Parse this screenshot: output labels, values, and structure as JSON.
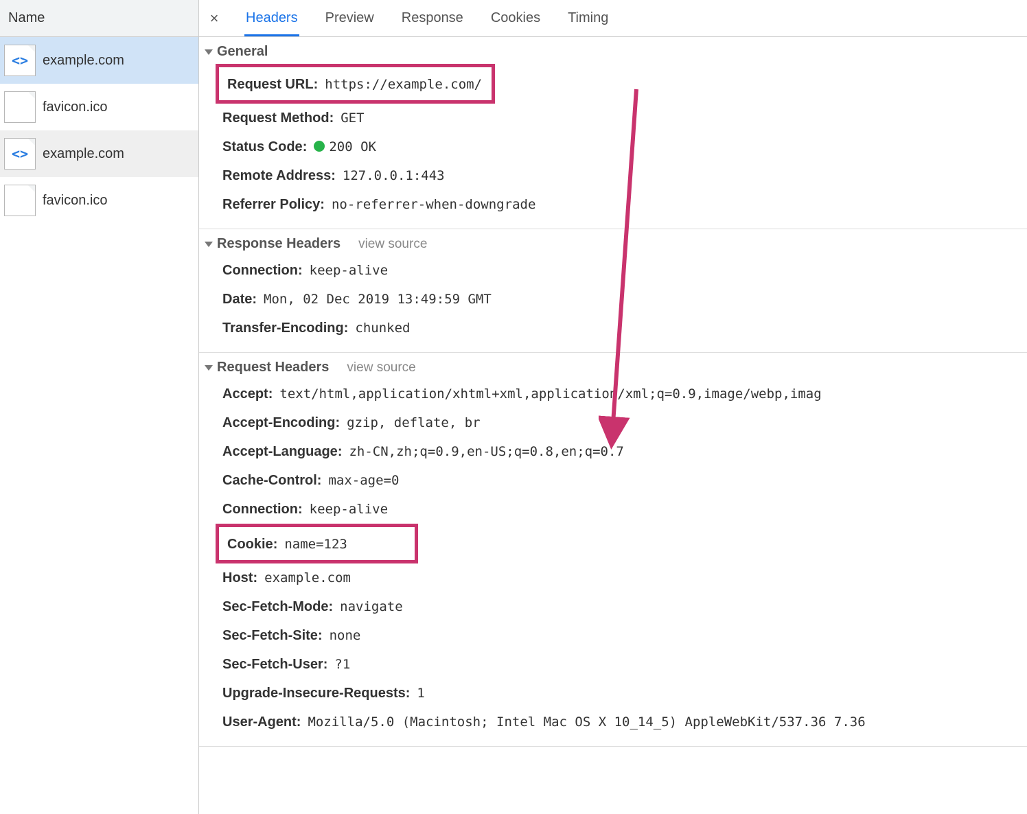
{
  "sidebar": {
    "header": "Name",
    "items": [
      {
        "label": "example.com",
        "icon": "doc",
        "selected": true,
        "striped": false
      },
      {
        "label": "favicon.ico",
        "icon": "blank",
        "selected": false,
        "striped": false
      },
      {
        "label": "example.com",
        "icon": "doc",
        "selected": false,
        "striped": true
      },
      {
        "label": "favicon.ico",
        "icon": "blank",
        "selected": false,
        "striped": false
      }
    ]
  },
  "tabs": {
    "close": "×",
    "items": [
      "Headers",
      "Preview",
      "Response",
      "Cookies",
      "Timing"
    ],
    "active": 0
  },
  "util": {
    "view_source": "view source"
  },
  "general": {
    "title": "General",
    "request_url": {
      "k": "Request URL",
      "v": "https://example.com/"
    },
    "request_method": {
      "k": "Request Method",
      "v": "GET"
    },
    "status_code": {
      "k": "Status Code",
      "v": "200 OK"
    },
    "remote_address": {
      "k": "Remote Address",
      "v": "127.0.0.1:443"
    },
    "referrer_policy": {
      "k": "Referrer Policy",
      "v": "no-referrer-when-downgrade"
    }
  },
  "response_headers": {
    "title": "Response Headers",
    "connection": {
      "k": "Connection",
      "v": "keep-alive"
    },
    "date": {
      "k": "Date",
      "v": "Mon, 02 Dec 2019 13:49:59 GMT"
    },
    "transfer_encoding": {
      "k": "Transfer-Encoding",
      "v": "chunked"
    }
  },
  "request_headers": {
    "title": "Request Headers",
    "accept": {
      "k": "Accept",
      "v": "text/html,application/xhtml+xml,application/xml;q=0.9,image/webp,imag"
    },
    "accept_encoding": {
      "k": "Accept-Encoding",
      "v": "gzip, deflate, br"
    },
    "accept_language": {
      "k": "Accept-Language",
      "v": "zh-CN,zh;q=0.9,en-US;q=0.8,en;q=0.7"
    },
    "cache_control": {
      "k": "Cache-Control",
      "v": "max-age=0"
    },
    "connection": {
      "k": "Connection",
      "v": "keep-alive"
    },
    "cookie": {
      "k": "Cookie",
      "v": "name=123"
    },
    "host": {
      "k": "Host",
      "v": "example.com"
    },
    "sec_fetch_mode": {
      "k": "Sec-Fetch-Mode",
      "v": "navigate"
    },
    "sec_fetch_site": {
      "k": "Sec-Fetch-Site",
      "v": "none"
    },
    "sec_fetch_user": {
      "k": "Sec-Fetch-User",
      "v": "?1"
    },
    "upgrade_insecure": {
      "k": "Upgrade-Insecure-Requests",
      "v": "1"
    },
    "user_agent": {
      "k": "User-Agent",
      "v": "Mozilla/5.0 (Macintosh; Intel Mac OS X 10_14_5) AppleWebKit/537.36 7.36"
    }
  },
  "annotation": {
    "color": "#c9336d"
  }
}
